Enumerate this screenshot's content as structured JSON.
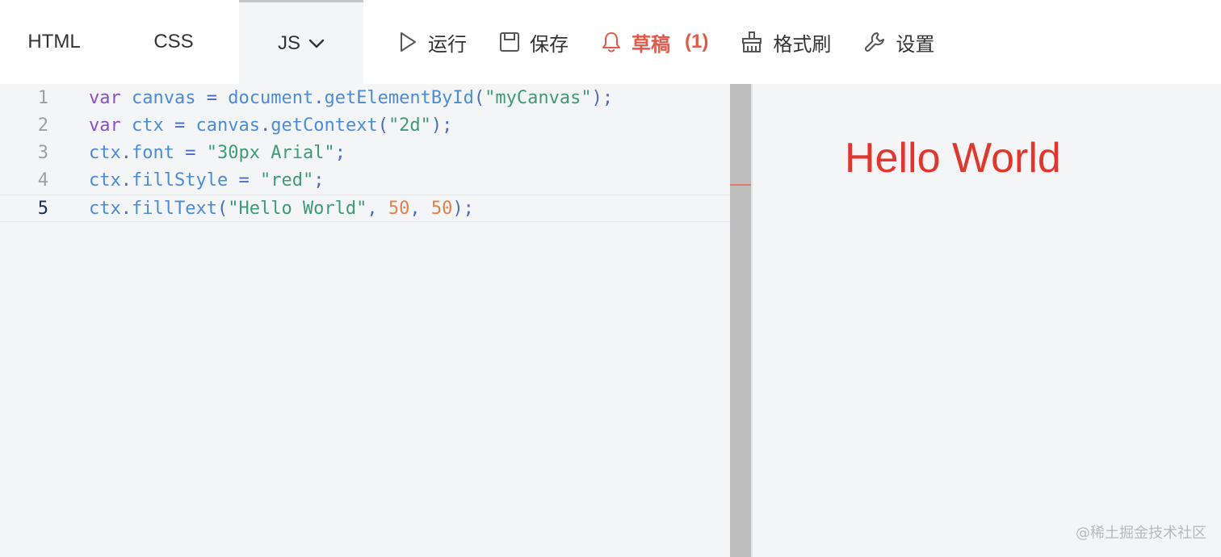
{
  "tabs": {
    "html": "HTML",
    "css": "CSS",
    "js": "JS"
  },
  "actions": {
    "run": "运行",
    "save": "保存",
    "draft": "草稿",
    "draft_count": "(1)",
    "format": "格式刷",
    "settings": "设置"
  },
  "icons": {
    "js_dropdown": "chevron-down-icon",
    "run": "play-icon",
    "save": "floppy-disk-icon",
    "draft": "bell-icon",
    "format": "format-brush-icon",
    "settings": "wrench-icon"
  },
  "colors": {
    "draft": "#e15a4a",
    "preview_text": "#e5342b"
  },
  "editor": {
    "lines": [
      {
        "num": "1",
        "tokens": [
          [
            "kw",
            "var"
          ],
          [
            "op",
            " "
          ],
          [
            "id",
            "canvas"
          ],
          [
            "op",
            " = "
          ],
          [
            "id",
            "document"
          ],
          [
            "op",
            "."
          ],
          [
            "id",
            "getElementById"
          ],
          [
            "op",
            "("
          ],
          [
            "str",
            "\"myCanvas\""
          ],
          [
            "op",
            ");"
          ]
        ]
      },
      {
        "num": "2",
        "tokens": [
          [
            "kw",
            "var"
          ],
          [
            "op",
            " "
          ],
          [
            "id",
            "ctx"
          ],
          [
            "op",
            " = "
          ],
          [
            "id",
            "canvas"
          ],
          [
            "op",
            "."
          ],
          [
            "id",
            "getContext"
          ],
          [
            "op",
            "("
          ],
          [
            "str",
            "\"2d\""
          ],
          [
            "op",
            ");"
          ]
        ]
      },
      {
        "num": "3",
        "tokens": [
          [
            "id",
            "ctx"
          ],
          [
            "op",
            "."
          ],
          [
            "id",
            "font"
          ],
          [
            "op",
            " = "
          ],
          [
            "str",
            "\"30px Arial\""
          ],
          [
            "op",
            ";"
          ]
        ]
      },
      {
        "num": "4",
        "tokens": [
          [
            "id",
            "ctx"
          ],
          [
            "op",
            "."
          ],
          [
            "id",
            "fillStyle"
          ],
          [
            "op",
            " = "
          ],
          [
            "str",
            "\"red\""
          ],
          [
            "op",
            ";"
          ]
        ]
      },
      {
        "num": "5",
        "tokens": [
          [
            "id",
            "ctx"
          ],
          [
            "op",
            "."
          ],
          [
            "id",
            "fillText"
          ],
          [
            "op",
            "("
          ],
          [
            "str",
            "\"Hello World\""
          ],
          [
            "op",
            ", "
          ],
          [
            "num",
            "50"
          ],
          [
            "op",
            ", "
          ],
          [
            "num",
            "50"
          ],
          [
            "op",
            ");"
          ]
        ]
      }
    ]
  },
  "preview": {
    "text": "Hello World"
  },
  "watermark": "@稀土掘金技术社区"
}
